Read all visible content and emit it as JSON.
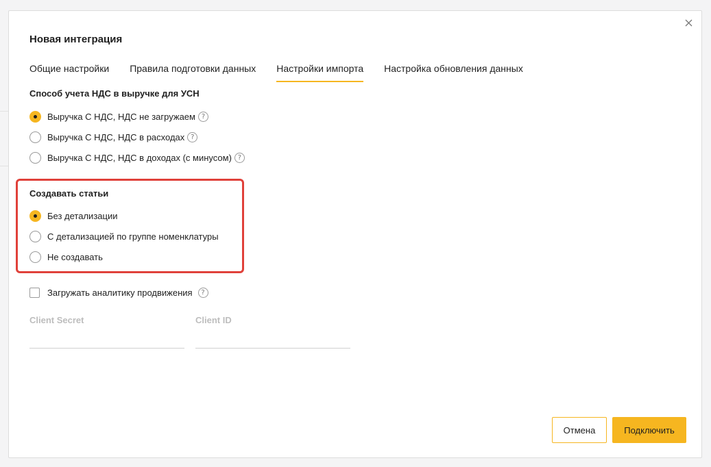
{
  "dialog": {
    "title": "Новая интеграция",
    "close_icon": "close-icon"
  },
  "tabs": [
    {
      "label": "Общие настройки",
      "active": false
    },
    {
      "label": "Правила подготовки данных",
      "active": false
    },
    {
      "label": "Настройки импорта",
      "active": true
    },
    {
      "label": "Настройка обновления данных",
      "active": false
    }
  ],
  "vat_section": {
    "title": "Способ учета НДС в выручке для УСН",
    "options": [
      {
        "label": "Выручка С НДС, НДС не загружаем",
        "checked": true,
        "help": "?"
      },
      {
        "label": "Выручка С НДС, НДС в расходах",
        "checked": false,
        "help": "?"
      },
      {
        "label": "Выручка С НДС, НДС в доходах (с минусом)",
        "checked": false,
        "help": "?"
      }
    ]
  },
  "articles_section": {
    "title": "Создавать статьи",
    "options": [
      {
        "label": "Без детализации",
        "checked": true
      },
      {
        "label": "С детализацией по группе номенклатуры",
        "checked": false
      },
      {
        "label": "Не создавать",
        "checked": false
      }
    ]
  },
  "promo_analytics": {
    "label": "Загружать аналитику продвижения",
    "checked": false,
    "help": "?"
  },
  "fields": {
    "client_secret": {
      "label": "Client Secret",
      "value": ""
    },
    "client_id": {
      "label": "Client ID",
      "value": ""
    }
  },
  "buttons": {
    "cancel": "Отмена",
    "connect": "Подключить"
  },
  "colors": {
    "accent": "#f6b620",
    "highlight": "#e0413a"
  }
}
